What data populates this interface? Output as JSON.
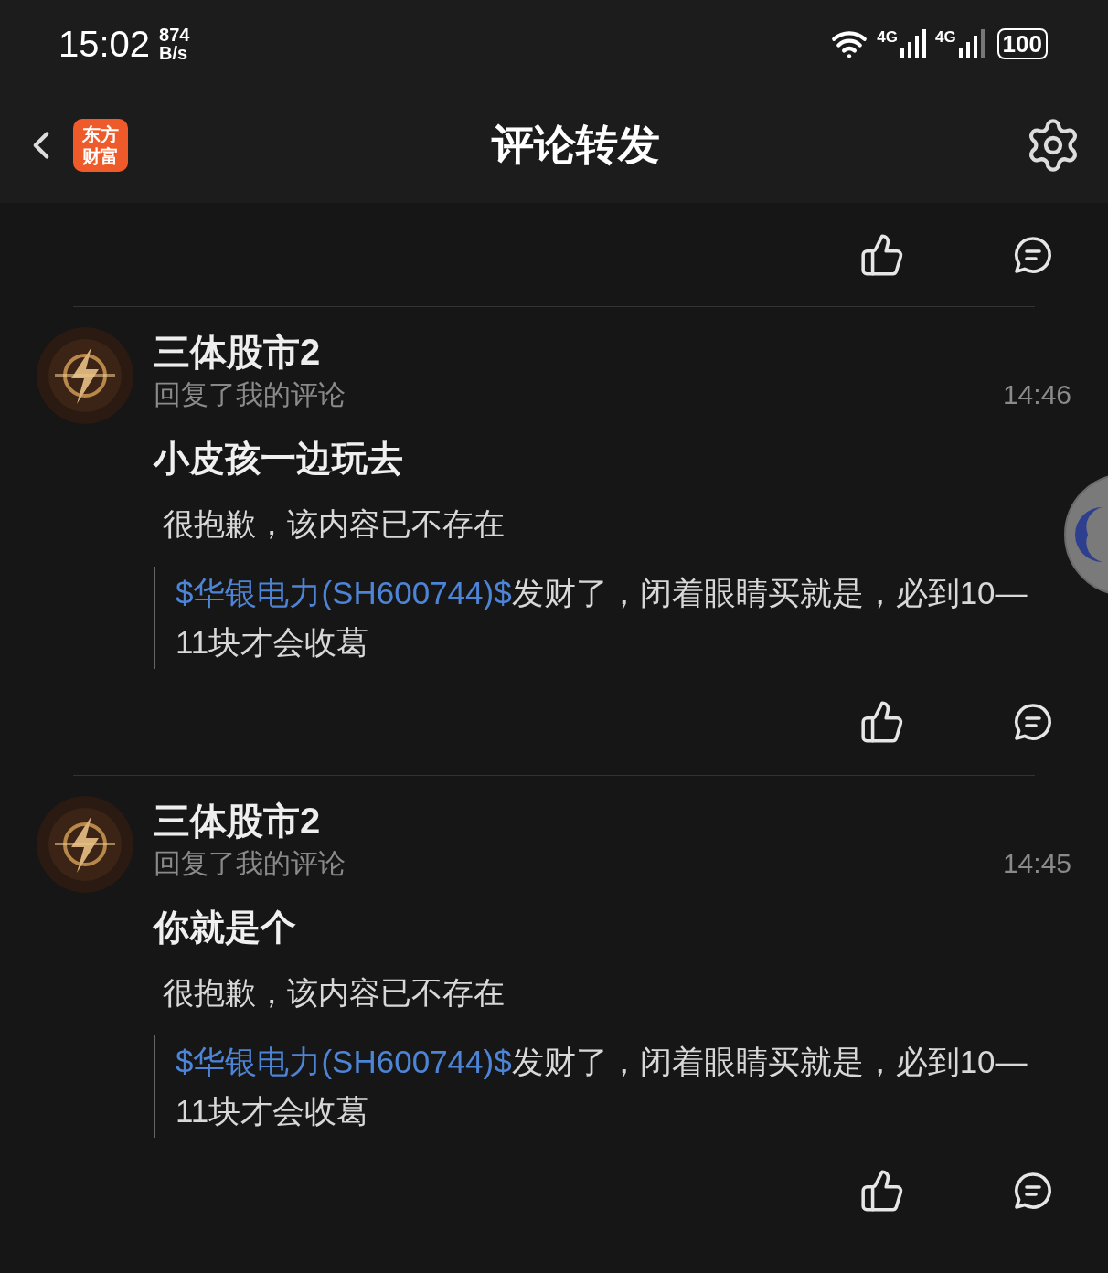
{
  "status_bar": {
    "time": "15:02",
    "net_speed": [
      "874",
      "B/s"
    ],
    "signals": [
      "4G",
      "4G"
    ],
    "battery": "100"
  },
  "header": {
    "logo": [
      "东方",
      "财富"
    ],
    "title": "评论转发"
  },
  "comments": [
    {
      "user": "三体股市2",
      "action": "回复了我的评论",
      "time": "14:46",
      "reply": "小皮孩一边玩去",
      "notice": "很抱歉，该内容已不存在",
      "quote": {
        "link": "$华银电力(SH600744)$",
        "text": "发财了，闭着眼睛买就是，必到10—11块才会收葛"
      }
    },
    {
      "user": "三体股市2",
      "action": "回复了我的评论",
      "time": "14:45",
      "reply": "你就是个",
      "notice": "很抱歉，该内容已不存在",
      "quote": {
        "link": "$华银电力(SH600744)$",
        "text": "发财了，闭着眼睛买就是，必到10—11块才会收葛"
      }
    }
  ]
}
